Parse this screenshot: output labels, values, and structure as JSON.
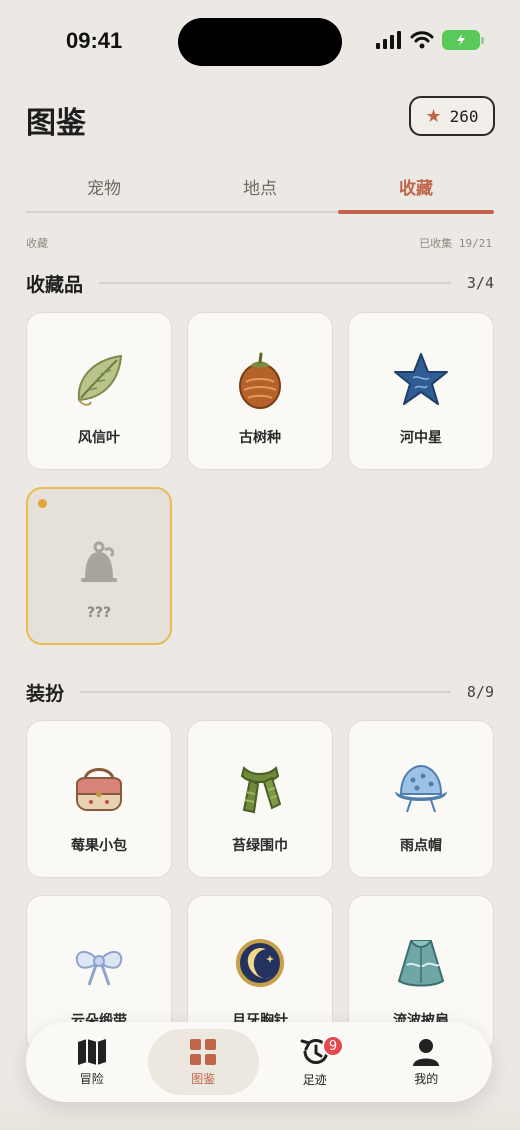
{
  "status": {
    "time": "09:41"
  },
  "header": {
    "title": "图鉴",
    "stars": "260"
  },
  "tabs": [
    {
      "label": "宠物"
    },
    {
      "label": "地点"
    },
    {
      "label": "收藏"
    }
  ],
  "breadcrumb": "收藏",
  "collected": "已收集 19/21",
  "sections": [
    {
      "title": "收藏品",
      "count": "3/4",
      "items": [
        {
          "label": "风信叶"
        },
        {
          "label": "古树种"
        },
        {
          "label": "河中星"
        },
        {
          "label": "???"
        }
      ]
    },
    {
      "title": "装扮",
      "count": "8/9",
      "items": [
        {
          "label": "莓果小包"
        },
        {
          "label": "苔绿围巾"
        },
        {
          "label": "雨点帽"
        },
        {
          "label": "云朵缎带"
        },
        {
          "label": "月牙胸针"
        },
        {
          "label": "流波披肩"
        }
      ]
    }
  ],
  "nav": [
    {
      "label": "冒险",
      "icon": "map-icon"
    },
    {
      "label": "图鉴",
      "icon": "grid-icon"
    },
    {
      "label": "足迹",
      "icon": "history-icon",
      "badge": "9"
    },
    {
      "label": "我的",
      "icon": "user-icon"
    }
  ],
  "colors": {
    "accent": "#C0654A",
    "background": "#ECE9E4",
    "badge": "#E5484D",
    "locked_border": "#E7BE55"
  }
}
